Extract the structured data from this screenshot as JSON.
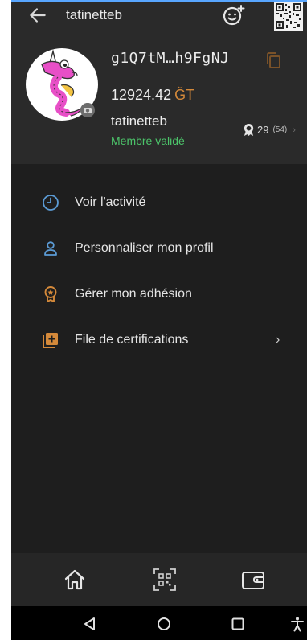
{
  "header": {
    "title": "tatinetteb",
    "back_icon": "arrow-left-icon",
    "smile_icon": "smiley-plus-icon",
    "qr_icon": "qr-code-icon"
  },
  "profile": {
    "public_key": "g1Q7tM…h9FgNJ",
    "balance_value": "12924.42",
    "balance_unit": "ĞT",
    "username": "tatinetteb",
    "status": "Membre validé",
    "certifications": "29",
    "certifications_extra": "(54)",
    "avatar_icon": "dragon-avatar",
    "camera_icon": "camera-icon",
    "copy_icon": "copy-icon"
  },
  "menu": {
    "items": [
      {
        "label": "Voir l'activité",
        "icon": "clock-icon"
      },
      {
        "label": "Personnaliser mon profil",
        "icon": "user-icon"
      },
      {
        "label": "Gérer mon adhésion",
        "icon": "badge-icon"
      },
      {
        "label": "File de certifications",
        "icon": "add-box-icon",
        "chevron": "›"
      }
    ]
  },
  "bottom_nav": {
    "items": [
      "home-icon",
      "qr-scan-icon",
      "wallet-icon"
    ]
  },
  "system_nav": {
    "items": [
      "back-triangle-icon",
      "home-circle-icon",
      "recents-square-icon",
      "accessibility-icon"
    ]
  },
  "colors": {
    "accent_orange": "#d4893a",
    "status_green": "#4cc46a",
    "icon_blue": "#5b9bd5"
  }
}
